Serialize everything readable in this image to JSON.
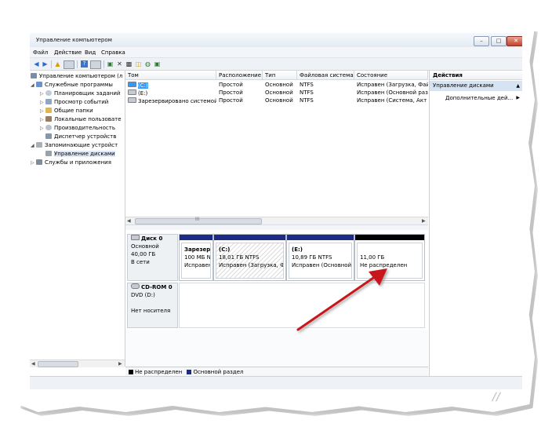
{
  "window": {
    "title": "Управление компьютером"
  },
  "menu": [
    "Файл",
    "Действие",
    "Вид",
    "Справка"
  ],
  "tree": [
    "Управление компьютером (л",
    "Служебные программы",
    "Планировщик заданий",
    "Просмотр событий",
    "Общие папки",
    "Локальные пользовате",
    "Производительность",
    "Диспетчер устройств",
    "Запоминающие устройст",
    "Управление дисками",
    "Службы и приложения"
  ],
  "volumes": {
    "columns": [
      "Том",
      "Расположение",
      "Тип",
      "Файловая система",
      "Состояние"
    ],
    "rows": [
      [
        "(C:)",
        "Простой",
        "Основной",
        "NTFS",
        "Исправен (Загрузка, Фай"
      ],
      [
        "(E:)",
        "Простой",
        "Основной",
        "NTFS",
        "Исправен (Основной раз"
      ],
      [
        "Зарезервировано системой",
        "Простой",
        "Основной",
        "NTFS",
        "Исправен (Система, Акт"
      ]
    ]
  },
  "disks": [
    {
      "name": "Диск 0",
      "type": "Основной",
      "size": "40,00 ГБ",
      "status": "В сети",
      "partitions": [
        {
          "name": "Зарезерв",
          "size": "100 МБ N",
          "status": "Исправен"
        },
        {
          "name": "(C:)",
          "size": "18,01 ГБ NTFS",
          "status": "Исправен (Загрузка, Фа"
        },
        {
          "name": "(E:)",
          "size": "10,89 ГБ NTFS",
          "status": "Исправен (Основной"
        },
        {
          "name": "",
          "size": "11,00 ГБ",
          "status": "Не распределен"
        }
      ]
    },
    {
      "name": "CD-ROM 0",
      "type": "DVD (D:)",
      "status": "Нет носителя"
    }
  ],
  "legend": [
    "Не распределен",
    "Основной раздел"
  ],
  "actions": {
    "header": "Действия",
    "section": "Управление дисками",
    "more": "Дополнительные дей..."
  },
  "colors": {
    "primary_partition": "#1b2b86",
    "unallocated": "#000000",
    "annotation_arrow": "#c8171d",
    "selection": "#3399ff"
  }
}
